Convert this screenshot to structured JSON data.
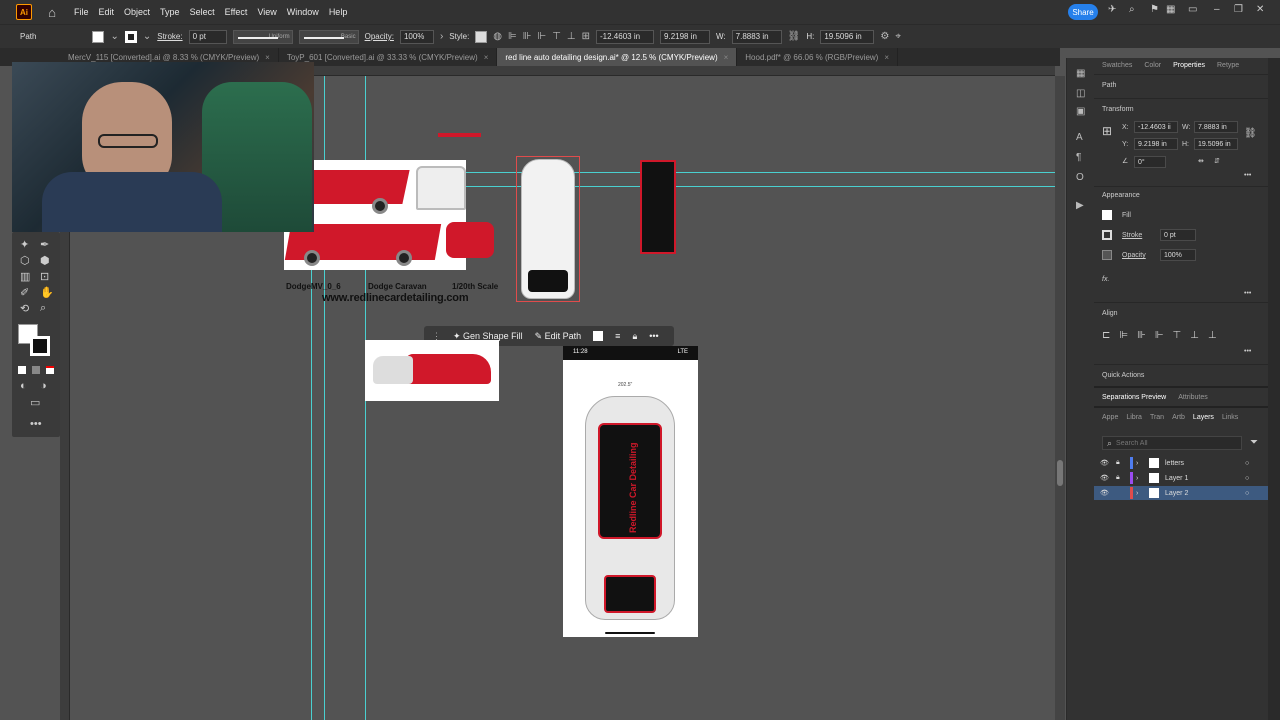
{
  "app": {
    "logo": "Ai",
    "menu": [
      "File",
      "Edit",
      "Object",
      "Type",
      "Select",
      "Effect",
      "View",
      "Window",
      "Help"
    ],
    "share_label": "Share"
  },
  "control_bar": {
    "selection_type": "Path",
    "stroke_label": "Stroke:",
    "stroke_value": "0 pt",
    "stroke_profile": "Uniform",
    "brush": "Basic",
    "opacity_label": "Opacity:",
    "opacity_value": "100%",
    "style_label": "Style:",
    "x_value": "-12.4603 in",
    "y_value": "9.2198 in",
    "w_label": "W:",
    "w_value": "7.8883 in",
    "h_label": "H:",
    "h_value": "19.5096 in"
  },
  "tabs": [
    {
      "label": "MercV_115 [Converted].ai @ 8.33 % (CMYK/Preview)",
      "active": false
    },
    {
      "label": "ToyP_601 [Converted].ai @ 33.33 % (CMYK/Preview)",
      "active": false
    },
    {
      "label": "red line auto detailing design.ai* @ 12.5 % (CMYK/Preview)",
      "active": true
    },
    {
      "label": "Hood.pdf* @ 66.06 % (RGB/Preview)",
      "active": false
    }
  ],
  "canvas": {
    "captions": [
      "DodgeMV_0_6",
      "Dodge Caravan",
      "1/20th Scale"
    ],
    "website": "www.redlinecardetailing.com",
    "contextual_bar": {
      "gen_shape_fill": "Gen Shape Fill",
      "edit_path": "Edit Path"
    },
    "phone": {
      "time": "11:28",
      "network": "LTE",
      "dimension": "202.5\""
    },
    "brand": "Redline Car Detailing"
  },
  "properties_panel": {
    "tabs": [
      "Swatches",
      "Color",
      "Properties",
      "Retype"
    ],
    "active_tab": "Properties",
    "object_type": "Path",
    "transform_label": "Transform",
    "x_label": "X:",
    "x_value": "-12.4603 ii",
    "y_label": "Y:",
    "y_value": "9.2198 in",
    "w_label": "W:",
    "w_value": "7.8883 in",
    "h_label": "H:",
    "h_value": "19.5096 in",
    "angle_value": "0°",
    "appearance_label": "Appearance",
    "fill_label": "Fill",
    "stroke_label": "Stroke",
    "stroke_value": "0 pt",
    "opacity_label": "Opacity",
    "opacity_value": "100%",
    "fx_label": "fx.",
    "align_label": "Align",
    "quick_actions_label": "Quick Actions"
  },
  "bottom_panel": {
    "tabs_top": [
      "Separations Preview",
      "Attributes"
    ],
    "tabs": [
      "Appe",
      "Libra",
      "Tran",
      "Artb",
      "Layers",
      "Links"
    ],
    "active_tab": "Layers",
    "search_placeholder": "Search All",
    "layers": [
      {
        "name": "letters",
        "color": "#4f7df0",
        "selected": false
      },
      {
        "name": "Layer 1",
        "color": "#9a4cf0",
        "selected": false
      },
      {
        "name": "Layer 2",
        "color": "#e04c4c",
        "selected": true
      }
    ]
  },
  "colors": {
    "accent": "#2680eb",
    "guide": "#4ad0d0",
    "brand_red": "#d0182a"
  }
}
